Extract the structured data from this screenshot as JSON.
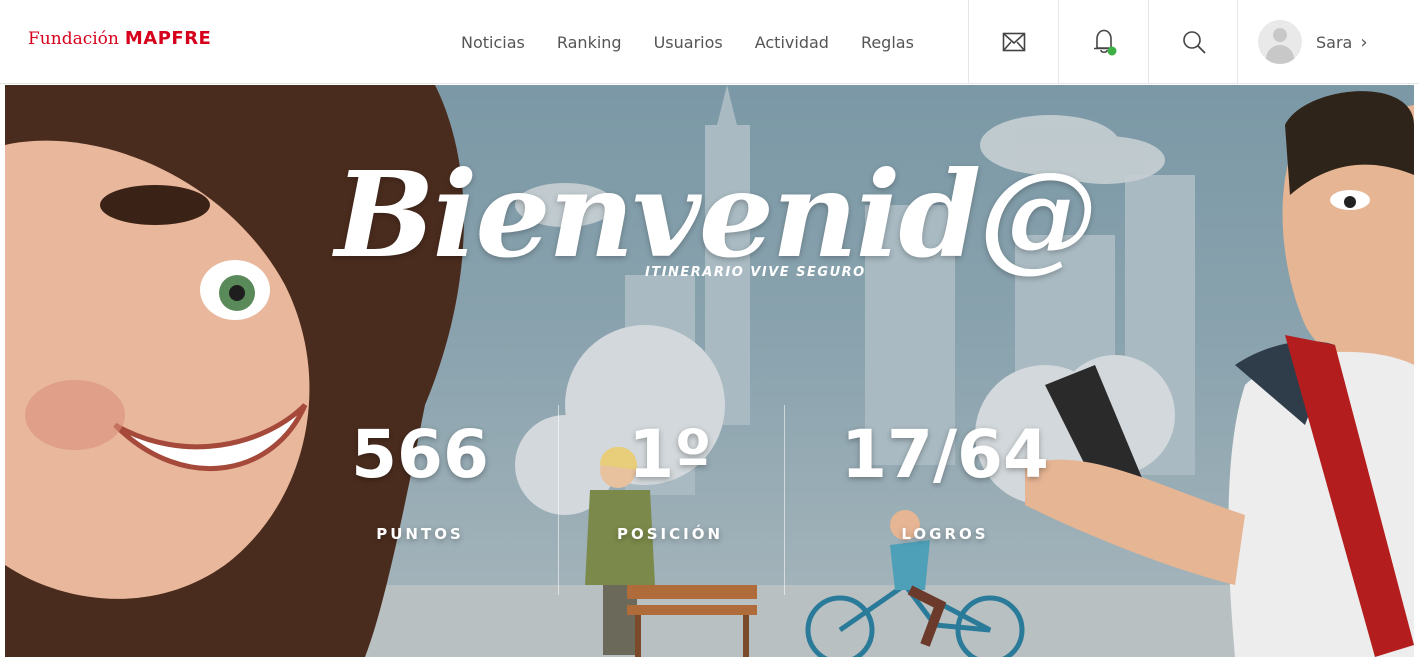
{
  "brand": {
    "text_a": "Fundación",
    "text_b": "MAPFRE",
    "color": "#d6001c"
  },
  "nav": [
    {
      "label": "Noticias"
    },
    {
      "label": "Ranking"
    },
    {
      "label": "Usuarios"
    },
    {
      "label": "Actividad"
    },
    {
      "label": "Reglas"
    }
  ],
  "icons": {
    "mail": "mail-icon",
    "notifications": "bell-icon",
    "search": "search-icon",
    "notification_dot_color": "#3cb043"
  },
  "user": {
    "name": "Sara",
    "chevron": "›"
  },
  "hero": {
    "title": "Bienvenid@",
    "subtitle": "ITINERARIO VIVE SEGURO",
    "stats": [
      {
        "value": "566",
        "label": "PUNTOS"
      },
      {
        "value": "1º",
        "label": "POSICIÓN"
      },
      {
        "value": "17/64",
        "label": "LOGROS"
      }
    ]
  }
}
